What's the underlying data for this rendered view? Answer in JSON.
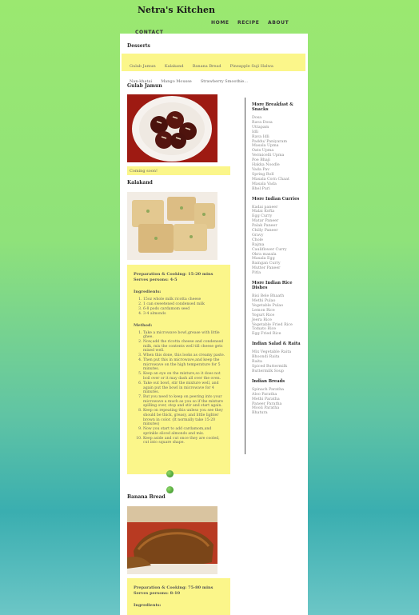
{
  "site": {
    "title": "Netra's Kitchen"
  },
  "nav": {
    "items": [
      "HOME",
      "RECIPE",
      "ABOUT",
      "CONTACT"
    ]
  },
  "category": {
    "title": "Desserts",
    "tags": [
      "Gulab Jamun",
      "Kalakand",
      "Banana Bread",
      "Pineapple Suji Halwa",
      "Nan-khatai",
      "Mango Mousse",
      "Strawberry Smoothie..."
    ]
  },
  "recipe1": {
    "title": "Gulab Jamun",
    "note": "Coming soon!"
  },
  "recipe2": {
    "title": "Kalakand",
    "prep": "Preparation & Cooking: 15-20 mins",
    "serves": "Serves persons: 4-5",
    "ingredients_label": "Ingredients:",
    "ingredients": [
      "15oz whole milk ricotta cheese",
      "1 can sweetened condensed milk",
      "6-8 pods cardamom seed",
      "3-4 almonds"
    ],
    "method_label": "Method:",
    "method": [
      "Take a microwave bowl,grease with little ghee.",
      "Now,add the ricotta cheese and condensed milk, mix the contents well till cheese gets mixed well.",
      "When this done, this looks as creamy paste.",
      "Then put this in microwave,and keep the microwave on the high temperature for 5 minutes.",
      "Keep an eye on the mixture,so it does not boil over or it may dash all over the oven.",
      "Take out bowl, stir the mixture well, and again put the bowl in microwave for 4 minutes.",
      "But you need to keep on peering into your microwave a much as you so if the mixture spilling over, stop and stir and start again.",
      "Keep on repeating this unless you see they should be thick, greasy, and little lighter brown in color. (It normally take 15-20 minutes)",
      "Now you start to add cardamom,and sprinkle sliced almonds and mix.",
      "Keep aside and cut once they are cooled, cut into square shape."
    ]
  },
  "recipe3": {
    "title": "Banana Bread",
    "prep": "Preparation & Cooking: 75-80 mins",
    "serves": "Serves persons: 8-10",
    "ingredients_label": "Ingredients:"
  },
  "sidebar": {
    "sections": [
      {
        "title": "More Breakfast & Snacks",
        "items": [
          "Dosa",
          "Rava Dosa",
          "Uttapam",
          "Idli",
          "Rava Idli",
          "Paddu/ Paniyaram",
          "Masala Upma",
          "Oats Upma",
          "Vermicelli Upma",
          "Poe Bhaji",
          "Hakka Noodle",
          "Vada Pav",
          "Spring Roll",
          "Masala Corn Chaat",
          "Masala Vada",
          "Bhel Puri"
        ]
      },
      {
        "title": "More Indian Curries",
        "items": [
          "Kadai paneer",
          "Malai Kofta",
          "Egg Curry",
          "Matar Paneer",
          "Palak Paneer",
          "Chilly Paneer",
          "Gravy",
          "Chole",
          "Rajma",
          "Cauliflower Curry",
          "Okra masala",
          "Masala Egg",
          "Baingan Curry",
          "Mutter Paneer",
          "Pitla"
        ]
      },
      {
        "title": "More Indian Rice Dishes",
        "items": [
          "Bisi Bele Bhaath",
          "Methi Pulao",
          "Vegetable Pulao",
          "Lemon Rice",
          "Yogurt Rice",
          "Jeera Rice",
          "Vegetable Fried Rice",
          "Tomato Rice",
          "Egg Fried Rice"
        ]
      },
      {
        "title": "Indian Salad & Raita",
        "items": [
          "Mix Vegetable Raita",
          "Bhoondi Raita",
          "Raita",
          "Spiced Buttermilk",
          "Buttermilk Soup"
        ]
      },
      {
        "title": "Indian Breads",
        "items": [
          "Spinach Paratha",
          "Aloo Paratha",
          "Methi Paratha",
          "Paneer Paratha",
          "Mooli Paratha",
          "Bhatura"
        ]
      }
    ]
  },
  "icons": {
    "gulab_jamun_photo": "gulab-jamun-image",
    "kalakand_photo": "kalakand-image",
    "banana_bread_photo": "banana-bread-image",
    "nav_dot": "green-button"
  }
}
